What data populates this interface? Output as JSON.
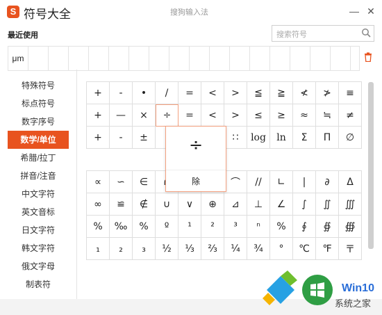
{
  "window": {
    "title": "符号大全",
    "subtitle": "搜狗输入法",
    "logo_letter": "S"
  },
  "controls": {
    "minimize": "—",
    "close": "✕"
  },
  "recent": {
    "label": "最近使用",
    "items": [
      "μm"
    ]
  },
  "search": {
    "placeholder": "搜索符号"
  },
  "sidebar": {
    "items": [
      {
        "label": "特殊符号",
        "active": false
      },
      {
        "label": "标点符号",
        "active": false
      },
      {
        "label": "数字序号",
        "active": false
      },
      {
        "label": "数学/单位",
        "active": true
      },
      {
        "label": "希腊/拉丁",
        "active": false
      },
      {
        "label": "拼音/注音",
        "active": false
      },
      {
        "label": "中文字符",
        "active": false
      },
      {
        "label": "英文音标",
        "active": false
      },
      {
        "label": "日文字符",
        "active": false
      },
      {
        "label": "韩文字符",
        "active": false
      },
      {
        "label": "俄文字母",
        "active": false
      },
      {
        "label": "制表符",
        "active": false
      }
    ]
  },
  "grid1": {
    "rows": [
      [
        "+",
        "-",
        "•",
        "/",
        "=",
        "<",
        ">",
        "≦",
        "≧",
        "≮",
        "≯",
        "≡"
      ],
      [
        "+",
        "—",
        "×",
        "÷",
        "=",
        "<",
        ">",
        "≤",
        "≥",
        "≈",
        "≒",
        "≠"
      ],
      [
        "+",
        "-",
        "±",
        "∶",
        "",
        "",
        "∷",
        "log",
        "ln",
        "Σ",
        "Π",
        "∅"
      ]
    ]
  },
  "grid2": {
    "rows": [
      [
        "∝",
        "∽",
        "∈",
        "∩",
        "",
        "",
        "⌒",
        "//",
        "∟",
        "|",
        "∂",
        "Δ"
      ],
      [
        "∞",
        "≌",
        "∉",
        "∪",
        "∨",
        "⊕",
        "⊿",
        "⊥",
        "∠",
        "∫",
        "∬",
        "∭"
      ],
      [
        "%",
        "‰",
        "%",
        "º",
        "¹",
        "²",
        "³",
        "ⁿ",
        "%",
        "∮",
        "∯",
        "∰"
      ],
      [
        "₁",
        "₂",
        "₃",
        "½",
        "⅓",
        "⅔",
        "¼",
        "¾",
        "°",
        "℃",
        "℉",
        "〒"
      ]
    ]
  },
  "popup": {
    "glyph": "÷",
    "name": "除"
  },
  "watermark": {
    "brand": "Win10",
    "site": "系统之家"
  },
  "colors": {
    "accent": "#e8531f",
    "popup_border": "#f3a07f"
  }
}
